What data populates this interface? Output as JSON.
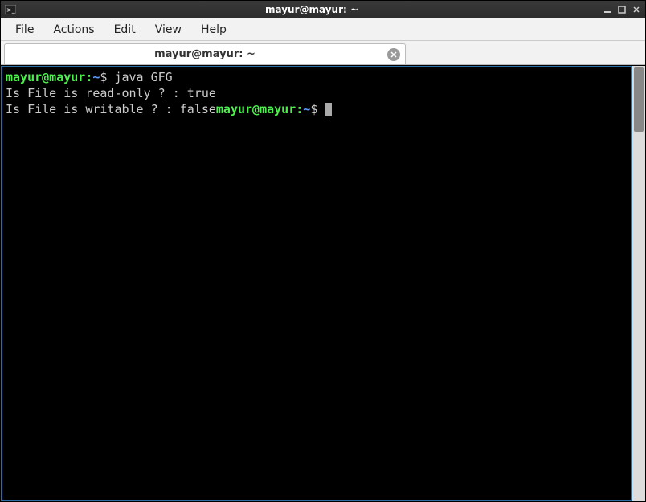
{
  "titlebar": {
    "title": "mayur@mayur: ~"
  },
  "menu": {
    "items": [
      "File",
      "Actions",
      "Edit",
      "View",
      "Help"
    ]
  },
  "tab": {
    "label": "mayur@mayur: ~"
  },
  "terminal": {
    "line1": {
      "user": "mayur@mayur",
      "sep": ":",
      "path": "~",
      "dollar": "$ ",
      "cmd": "java GFG"
    },
    "line2": "Is File is read-only ? : true",
    "line3_out": "Is File is writable ? : false",
    "line3_prompt": {
      "user": "mayur@mayur",
      "sep": ":",
      "path": "~",
      "dollar": "$ "
    }
  }
}
